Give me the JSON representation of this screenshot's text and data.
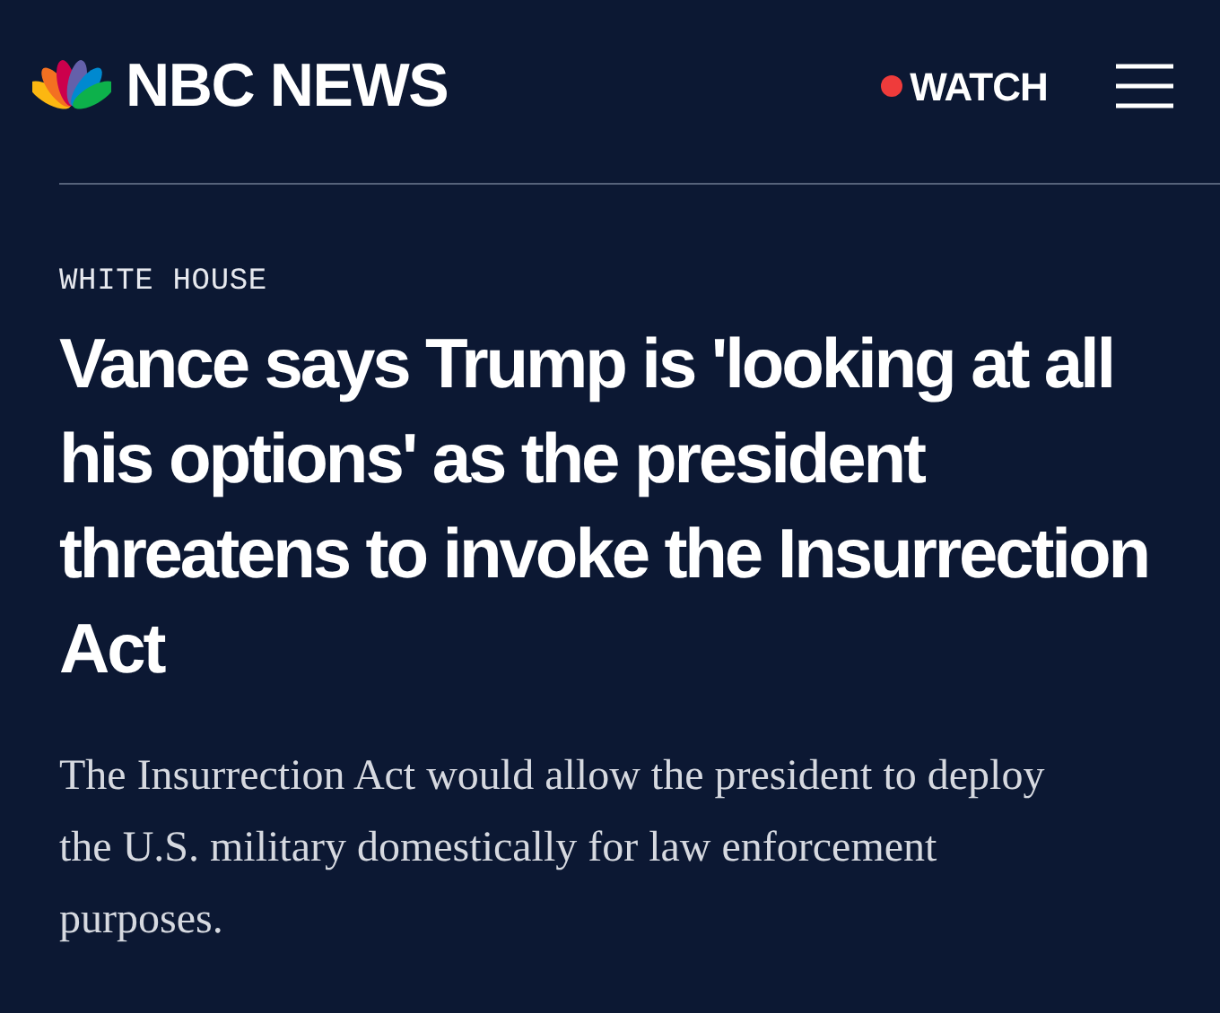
{
  "header": {
    "logo_text": "NBC NEWS",
    "watch_label": "WATCH"
  },
  "article": {
    "category": "WHITE HOUSE",
    "headline": "Vance says Trump is 'looking at all his options' as the president threatens to invoke the Insurrection Act",
    "dek": "The Insurrection Act would allow the president to deploy the U.S. military domestically for law enforcement purposes."
  }
}
